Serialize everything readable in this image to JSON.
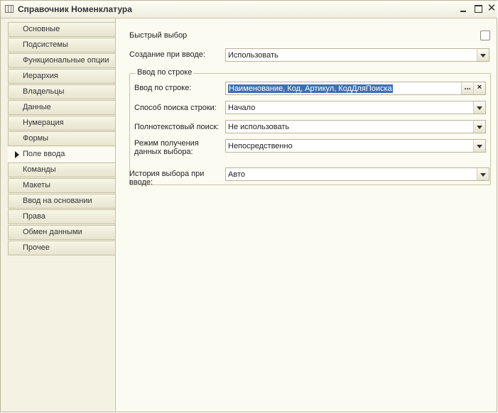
{
  "window": {
    "title": "Справочник Номенклатура"
  },
  "sidebar": {
    "items": [
      {
        "label": "Основные"
      },
      {
        "label": "Подсистемы"
      },
      {
        "label": "Функциональные опции"
      },
      {
        "label": "Иерархия"
      },
      {
        "label": "Владельцы"
      },
      {
        "label": "Данные"
      },
      {
        "label": "Нумерация"
      },
      {
        "label": "Формы"
      },
      {
        "label": "Поле ввода",
        "active": true
      },
      {
        "label": "Команды"
      },
      {
        "label": "Макеты"
      },
      {
        "label": "Ввод на основании"
      },
      {
        "label": "Права"
      },
      {
        "label": "Обмен данными"
      },
      {
        "label": "Прочее"
      }
    ]
  },
  "form": {
    "quick_select": {
      "label": "Быстрый выбор",
      "checked": false
    },
    "create_on_input": {
      "label": "Создание при вводе:",
      "value": "Использовать"
    },
    "group_title": "Ввод по строке",
    "input_by_string": {
      "label": "Ввод по строке:",
      "value": "Наименование, Код, Артикул, КодДляПоиска",
      "ellipsis": "...",
      "clear": "×"
    },
    "search_method": {
      "label": "Способ поиска строки:",
      "value": "Начало"
    },
    "fulltext_search": {
      "label": "Полнотекстовый поиск:",
      "value": "Не использовать"
    },
    "data_mode": {
      "label_line1": "Режим получения",
      "label_line2": "данных выбора:",
      "value": "Непосредственно"
    },
    "history": {
      "label_line1": "История выбора при",
      "label_line2": "вводе:",
      "value": "Авто"
    }
  }
}
